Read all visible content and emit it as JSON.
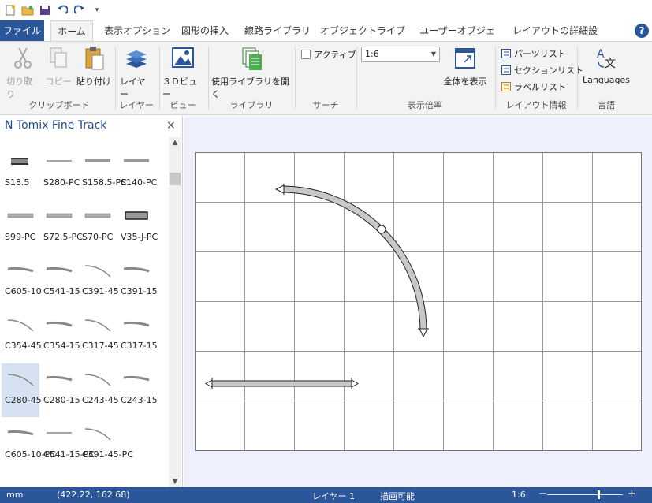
{
  "tabs": [
    "ファイル",
    "ホーム",
    "表示オプション",
    "図形の挿入",
    "線路ライブラリ",
    "オブジェクトライブラリ",
    "ユーザーオブジェクト",
    "レイアウトの詳細設定"
  ],
  "help": "?",
  "ribbon": {
    "clipboard": {
      "cut": "切り取り",
      "copy": "コピー",
      "paste": "貼り付け",
      "label": "クリップボード"
    },
    "layer": {
      "button": "レイヤー",
      "label": "レイヤー"
    },
    "view": {
      "button": "３Ｄビュー",
      "label": "ビュー"
    },
    "library": {
      "button": "使用ライブラリを開く",
      "label": "ライブラリ"
    },
    "search": {
      "checkbox": "アクティブ",
      "label": "サーチ"
    },
    "zoom": {
      "value": "1:6",
      "fit": "全体を表示",
      "label": "表示倍率"
    },
    "layout_info": {
      "parts": "パーツリスト",
      "sections": "セクションリスト",
      "labels": "ラベルリスト",
      "label": "レイアウト情報"
    },
    "language": {
      "button": "Languages",
      "label": "言語"
    }
  },
  "panel": {
    "title": "N Tomix Fine Track",
    "close": "×",
    "parts": [
      {
        "label": "S18.5",
        "kind": "short"
      },
      {
        "label": "S280-PC",
        "kind": "thin"
      },
      {
        "label": "S158.5-PC",
        "kind": "mid"
      },
      {
        "label": "S140-PC",
        "kind": "mid"
      },
      {
        "label": "S99-PC",
        "kind": "double"
      },
      {
        "label": "S72.5-PC",
        "kind": "double"
      },
      {
        "label": "S70-PC",
        "kind": "double"
      },
      {
        "label": "V35-J-PC",
        "kind": "boxed"
      },
      {
        "label": "C605-10",
        "kind": "curve1"
      },
      {
        "label": "C541-15",
        "kind": "curve1"
      },
      {
        "label": "C391-45",
        "kind": "curve2"
      },
      {
        "label": "C391-15",
        "kind": "curve1"
      },
      {
        "label": "C354-45",
        "kind": "curve2"
      },
      {
        "label": "C354-15",
        "kind": "curve1"
      },
      {
        "label": "C317-45",
        "kind": "curve2"
      },
      {
        "label": "C317-15",
        "kind": "curve1"
      },
      {
        "label": "C280-45",
        "kind": "curve2",
        "selected": true
      },
      {
        "label": "C280-15",
        "kind": "curve1"
      },
      {
        "label": "C243-45",
        "kind": "curve2"
      },
      {
        "label": "C243-15",
        "kind": "curve1"
      },
      {
        "label": "C605-10-PC",
        "kind": "curve1"
      },
      {
        "label": "C541-15-PC",
        "kind": "thin"
      },
      {
        "label": "C391-45-PC",
        "kind": "curve2"
      }
    ]
  },
  "status": {
    "unit": "mm",
    "coords": "(422.22, 162.68)",
    "layer": "レイヤー 1",
    "mode": "描画可能",
    "zoom": "1:6",
    "zoom_minus": "−",
    "zoom_plus": "+"
  }
}
